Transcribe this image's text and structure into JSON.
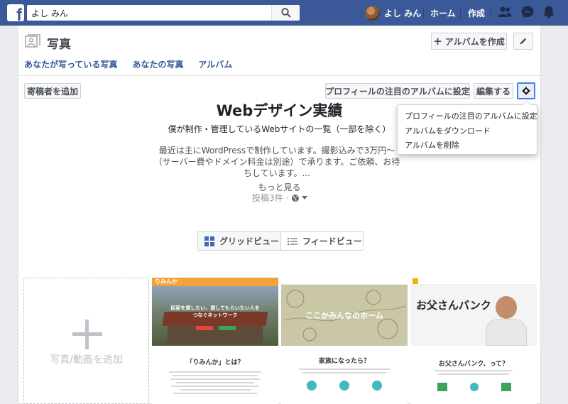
{
  "topbar": {
    "search_value": "よし みん",
    "user_name": "よし みん",
    "home": "ホーム",
    "create": "作成"
  },
  "header": {
    "title": "写真",
    "create_album": "アルバムを作成",
    "tabs": [
      "あなたが写っている写真",
      "あなたの写真",
      "アルバム"
    ]
  },
  "toolbar": {
    "add_contributor": "寄稿者を追加",
    "feature_on_profile": "プロフィールの注目のアルバムに設定",
    "edit": "編集する"
  },
  "album": {
    "title": "Webデザイン実績",
    "subtitle": "僕が制作・管理しているWebサイトの一覧（一部を除く）",
    "description": "最近は主にWordPressで制作しています。撮影込みで3万円〜（サーバー費やドメイン料金は別途）で承ります。ご依頼、お待ちしています。...",
    "more": "もっと見る",
    "posts": "投稿3件 ·"
  },
  "view_toggle": {
    "grid": "グリッドビュー",
    "feed": "フィードビュー"
  },
  "dropdown": {
    "items": [
      "プロフィールの注目のアルバムに設定",
      "アルバムをダウンロード",
      "アルバムを削除"
    ]
  },
  "grid": {
    "add_label": "写真/動画を追加",
    "thumbs": [
      {
        "brand": "りみんか",
        "headline": "民家を貸したい、貸してもらいたい人を",
        "headline2": "つなぐネットワーク",
        "caption": "「りみんか」とは？"
      },
      {
        "headline": "ここかみんなのホーム",
        "caption": "家族になったら？"
      },
      {
        "headline": "お父さんバンク",
        "caption": "お父さんバンク、って？"
      }
    ]
  },
  "colors": {
    "brand_blue": "#3b5998",
    "link_blue": "#365899",
    "panel_bg": "#ffffff",
    "page_bg": "#e9ebee"
  }
}
